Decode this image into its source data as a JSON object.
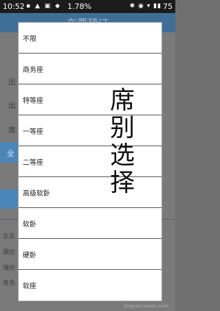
{
  "status_bar": {
    "time": "10:52",
    "battery_percent": "1.78%",
    "battery_level": "75"
  },
  "app_bar": {
    "title": "车票预订"
  },
  "background": {
    "labels": [
      "出",
      "出",
      "席",
      "全",
      "北京",
      "烟台",
      "潍坊",
      "青岛"
    ]
  },
  "dialog": {
    "items": [
      "不限",
      "商务座",
      "特等座",
      "一等座",
      "二等座",
      "高级软卧",
      "软卧",
      "硬卧",
      "软座"
    ]
  },
  "annotation": [
    "席",
    "别",
    "选",
    "择"
  ],
  "watermark": "jingyan.baidu.com"
}
